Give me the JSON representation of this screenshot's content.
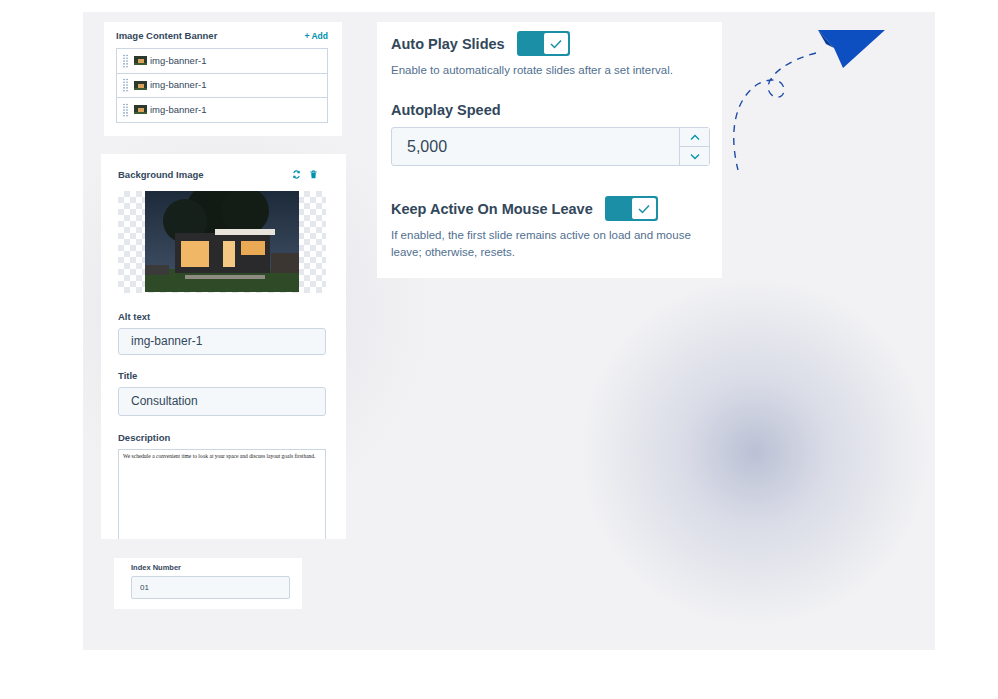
{
  "banner_list": {
    "title": "Image Content Banner",
    "add_button": "+ Add",
    "items": [
      {
        "label": "img-banner-1"
      },
      {
        "label": "img-banner-1"
      },
      {
        "label": "img-banner-1"
      }
    ]
  },
  "background_image": {
    "title": "Background Image",
    "alt_text": {
      "label": "Alt text",
      "value": "img-banner-1"
    },
    "title_field": {
      "label": "Title",
      "value": "Consultation"
    },
    "description": {
      "label": "Description",
      "value": "We schedule a convenient time to look at your space and discuss layout goals firsthand."
    }
  },
  "index_number": {
    "label": "Index Number",
    "value": "01"
  },
  "settings": {
    "auto_play": {
      "label": "Auto Play Slides",
      "on": true,
      "help": "Enable to automatically rotate slides after a set interval."
    },
    "autoplay_speed": {
      "label": "Autoplay Speed",
      "value": "5,000"
    },
    "keep_active": {
      "label": "Keep Active On Mouse Leave",
      "on": true,
      "help": "If enabled, the first slide remains active on load and mouse leave; otherwise, resets."
    }
  }
}
